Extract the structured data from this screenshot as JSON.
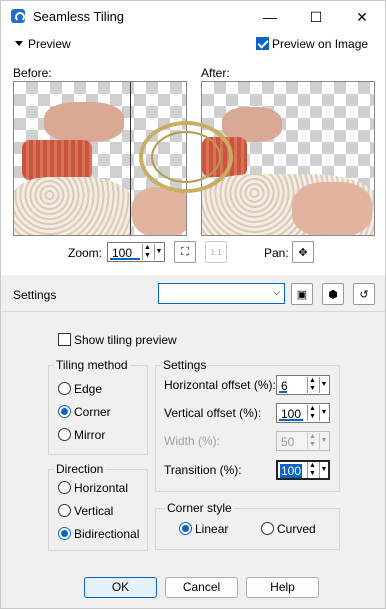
{
  "window": {
    "title": "Seamless Tiling"
  },
  "titlebar": {
    "minimize": "—",
    "maximize": "☐",
    "close": "✕"
  },
  "preview_section": {
    "label": "Preview",
    "preview_on_image": {
      "label": "Preview on Image",
      "checked": true
    },
    "before_label": "Before:",
    "after_label": "After:",
    "zoom": {
      "label": "Zoom:",
      "value": "100"
    },
    "pan": {
      "label": "Pan:",
      "icon": "✥"
    }
  },
  "settings_bar": {
    "label": "Settings",
    "preset_value": ""
  },
  "show_tiling_preview": {
    "label": "Show tiling preview",
    "checked": false
  },
  "tiling_method": {
    "title": "Tiling method",
    "options": [
      {
        "label": "Edge",
        "selected": false
      },
      {
        "label": "Corner",
        "selected": true
      },
      {
        "label": "Mirror",
        "selected": false
      }
    ]
  },
  "direction": {
    "title": "Direction",
    "options": [
      {
        "label": "Horizontal",
        "selected": false
      },
      {
        "label": "Vertical",
        "selected": false
      },
      {
        "label": "Bidirectional",
        "selected": true
      }
    ]
  },
  "settings": {
    "title": "Settings",
    "horizontal_offset": {
      "label": "Horizontal offset (%):",
      "value": "6"
    },
    "vertical_offset": {
      "label": "Vertical offset (%):",
      "value": "100"
    },
    "width": {
      "label": "Width (%):",
      "value": "50",
      "disabled": true
    },
    "transition": {
      "label": "Transition (%):",
      "value": "100"
    }
  },
  "corner_style": {
    "title": "Corner style",
    "options": [
      {
        "label": "Linear",
        "selected": true
      },
      {
        "label": "Curved",
        "selected": false
      }
    ]
  },
  "buttons": {
    "ok": "OK",
    "cancel": "Cancel",
    "help": "Help"
  },
  "colors": {
    "accent": "#0a64c8",
    "dialog_bg": "#f0f0f0"
  }
}
